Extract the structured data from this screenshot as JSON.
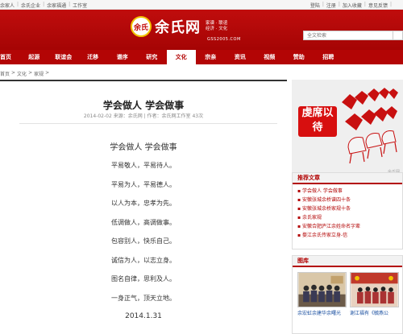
{
  "topbar": {
    "left": [
      "余家人",
      "余氏企业",
      "余家福通",
      "工作室"
    ],
    "right": [
      "登陆",
      "注册",
      "加入收藏",
      "意见反馈"
    ]
  },
  "header": {
    "logo_seal": "余氏",
    "logo_name": "余氏网",
    "logo_slogan": [
      "家谱 · 联谊",
      "经济 · 文化"
    ],
    "logo_url": "GSS2005.COM"
  },
  "search": {
    "placeholder": "全文检索"
  },
  "nav": {
    "items": [
      "首页",
      "起源",
      "联谊会",
      "迁移",
      "谱序",
      "研究",
      "文化",
      "宗亲",
      "资讯",
      "视频",
      "赞助",
      "招聘"
    ],
    "active_index": 6
  },
  "breadcrumb": [
    "首页",
    ">",
    "文化",
    ">",
    "家规",
    ">"
  ],
  "article": {
    "title": "学会做人 学会做事",
    "meta": "2014-02-02   来源：余氏网 | 作者：余氏网工作室   43次",
    "subtitle": "学会做人 学会做事",
    "lines": [
      "平易敬人，平易待人。",
      "平易为人，平易德人。",
      "以人为本，忠孝为先。",
      "低调做人，高调做事。",
      "包容别人，快乐自己。",
      "诚信为人，以志立身。",
      "图名自律，思利及人。",
      "一身正气，顶天立地。"
    ],
    "date": "2014.1.31"
  },
  "sidebar": {
    "banner_text": "虔席以待",
    "banner_watermark": "余氏网",
    "recommended_title": "推荐文章",
    "recommended": [
      "学会做人 学会做事",
      "安徽张城余桥谱四十条",
      "安徽张城余桥家规十条",
      "余氏家规",
      "安徽合肥庐江余姓命名字辈",
      "婺江余氏传家立身-信"
    ],
    "gallery_title": "图库",
    "gallery": [
      "余宏虹余建华余曙光",
      "谢江福有《毓燕公"
    ]
  },
  "colors": {
    "brand_red": "#b30505",
    "header_red": "#c00d0d",
    "link_blue": "#1a4fa0"
  }
}
